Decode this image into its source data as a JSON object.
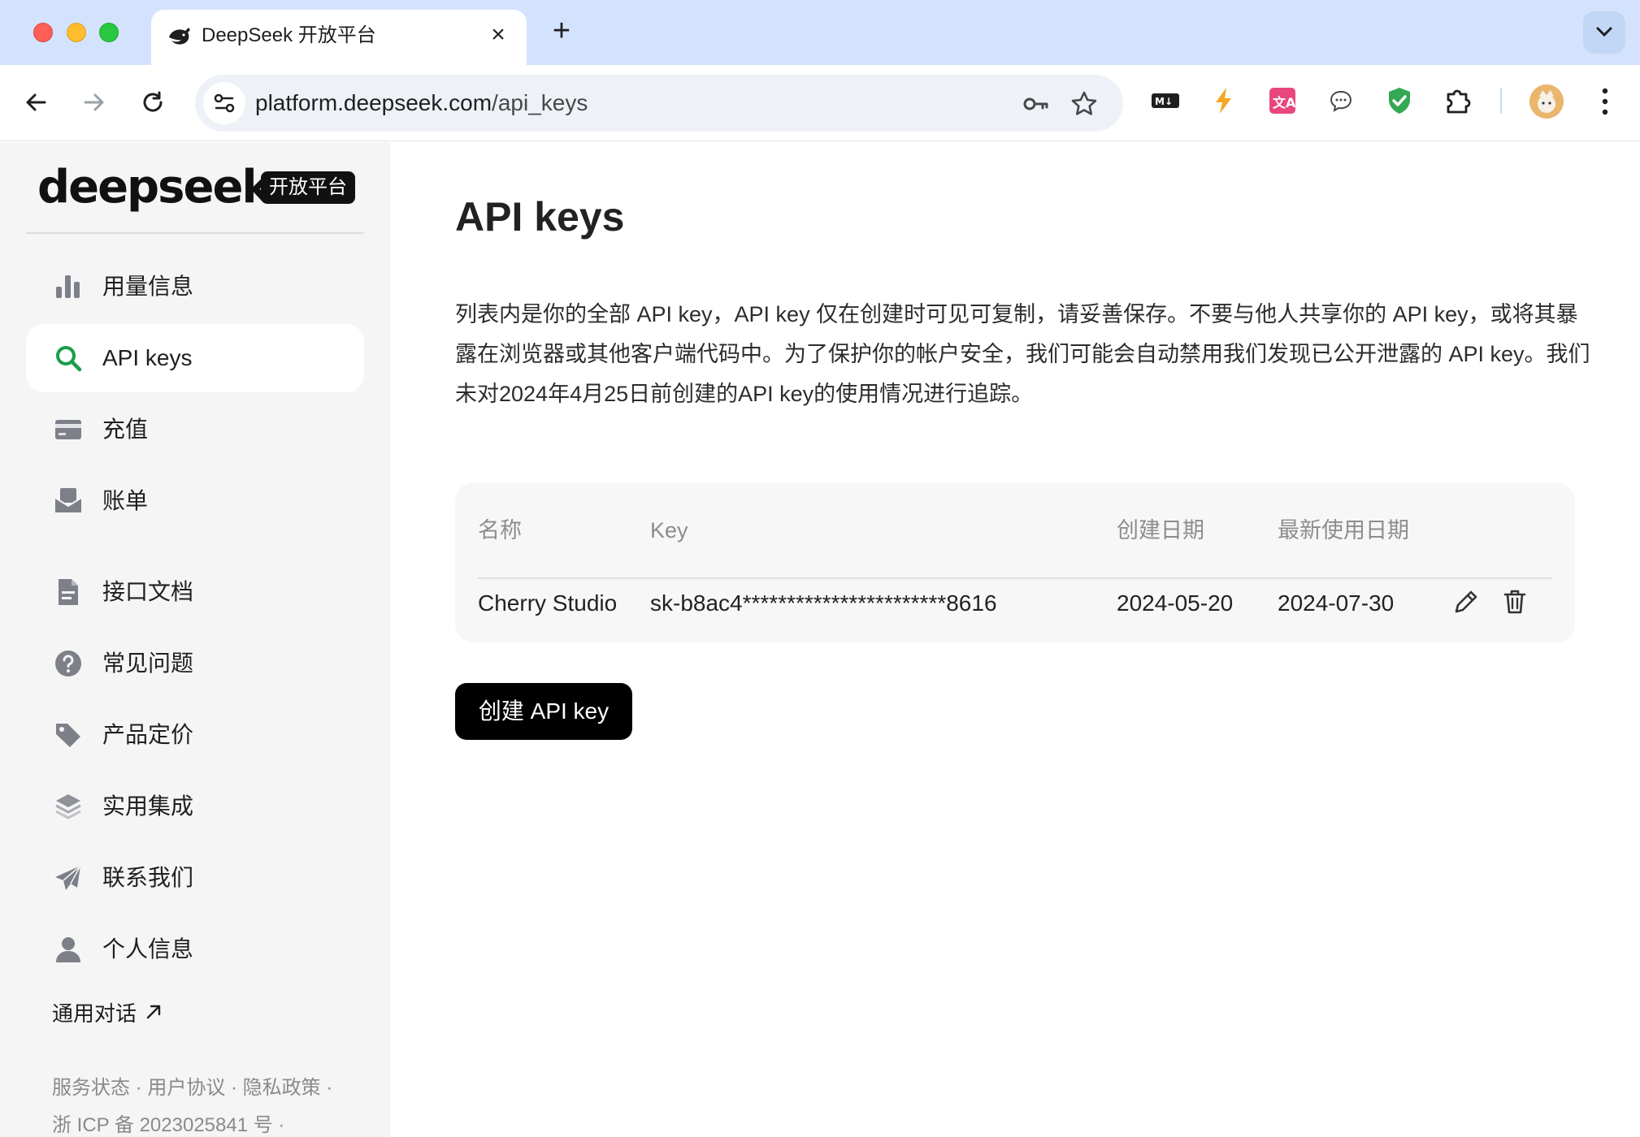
{
  "browser": {
    "tab_title": "DeepSeek 开放平台",
    "url_host": "platform.deepseek.com",
    "url_path": "/api_keys",
    "new_tab_glyph": "+",
    "close_glyph": "×",
    "extension_icons": [
      "markdown-icon",
      "lightning-icon",
      "translate-icon",
      "chat-bubble-icon",
      "shield-check-icon",
      "puzzle-icon"
    ]
  },
  "sidebar": {
    "logo_text": "deepseek",
    "logo_badge": "开放平台",
    "items": [
      {
        "label": "用量信息",
        "icon": "bar-chart-icon"
      },
      {
        "label": "API keys",
        "icon": "search-key-icon",
        "active": true
      },
      {
        "label": "充值",
        "icon": "card-icon"
      },
      {
        "label": "账单",
        "icon": "mail-bill-icon"
      },
      {
        "label": "接口文档",
        "icon": "document-icon"
      },
      {
        "label": "常见问题",
        "icon": "question-icon"
      },
      {
        "label": "产品定价",
        "icon": "tag-icon"
      },
      {
        "label": "实用集成",
        "icon": "layers-icon"
      },
      {
        "label": "联系我们",
        "icon": "send-icon"
      },
      {
        "label": "个人信息",
        "icon": "user-icon"
      }
    ],
    "external_link": "通用对话",
    "footer_line1": "服务状态 · 用户协议 · 隐私政策 ·",
    "footer_line2": "浙 ICP 备 2023025841 号 ·"
  },
  "main": {
    "title": "API keys",
    "description": "列表内是你的全部 API key，API key 仅在创建时可见可复制，请妥善保存。不要与他人共享你的 API key，或将其暴露在浏览器或其他客户端代码中。为了保护你的帐户安全，我们可能会自动禁用我们发现已公开泄露的 API key。我们未对2024年4月25日前创建的API key的使用情况进行追踪。",
    "table": {
      "headers": {
        "name": "名称",
        "key": "Key",
        "created": "创建日期",
        "last_used": "最新使用日期"
      },
      "rows": [
        {
          "name": "Cherry Studio",
          "key": "sk-b8ac4***********************8616",
          "created": "2024-05-20",
          "last_used": "2024-07-30"
        }
      ]
    },
    "create_button": "创建 API key"
  },
  "colors": {
    "accent_green": "#1a9d4b",
    "sidebar_bg": "#f5f5f5",
    "button_bg": "#000000",
    "chrome_bg": "#d3e3fd"
  }
}
